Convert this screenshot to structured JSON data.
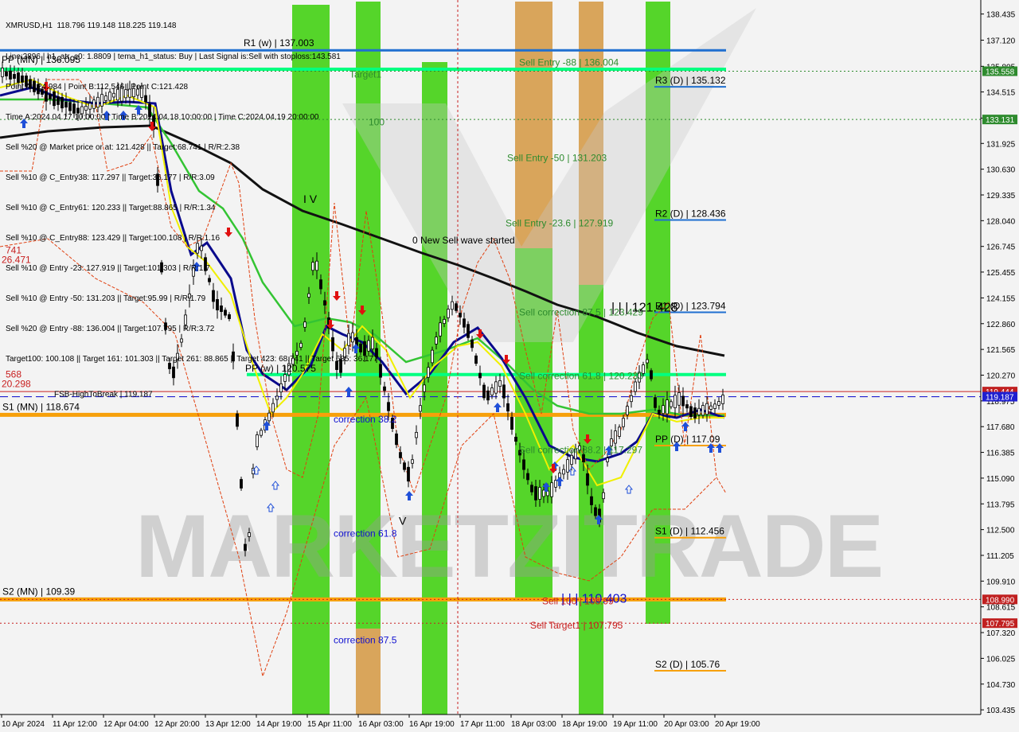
{
  "colors": {
    "background": "#f3f3f3",
    "green_zone": "#55d52a",
    "orange_zone": "#d9a55b",
    "pivot_line": "#1f6fd0",
    "support_line": "#f7a00a",
    "target_line": "#00ff80",
    "sma_black": "#111111",
    "ma_green": "#33c433",
    "ma_navy": "#0a0a8c",
    "ma_yellow": "#f0f000",
    "red_level": "#c82020",
    "current_price_bg": "#1f1fd0",
    "level_green_bg": "#2e8b2e",
    "level_red_bg": "#c02020"
  },
  "info_lines": [
    "XMRUSD,H1  118.796 119.148 118.225 119.148",
    "Line:2896 | h1_atr_c0: 1.8809 | tema_h1_status: Buy | Last Signal is:Sell with stoploss:143.581",
    "Point A:124.984 | Point B:112.546 | Point C:121.428",
    "Time A:2024.04.17 10:00:00 | Time B:2024.04.18 10:00:00 | Time C:2024.04.19 20:00:00",
    "Sell %20 @ Market price or at: 121.428 || Target:68.741 | R/R:2.38",
    "Sell %10 @ C_Entry38: 117.297 || Target:36.177 | R/R:3.09",
    "Sell %10 @ C_Entry61: 120.233 || Target:88.865 | R/R:1.34",
    "Sell %10 @ C_Entry88: 123.429 || Target:100.108 | R/R:1.16",
    "Sell %10 @ Entry -23: 127.919 || Target:101.303 | R/R:1.7",
    "Sell %10 @ Entry -50: 131.203 || Target:95.99 | R/R:1.79",
    "Sell %20 @ Entry -88: 136.004 || Target:107.795 | R/R:3.72",
    "Target100: 100.108 || Target 161: 101.303 || Target 261: 88.865 || Target 423: 68.741 || Target 685: 36.177"
  ],
  "chart_data": {
    "type": "candlestick",
    "symbol": "XMRUSD",
    "timeframe": "H1",
    "ylim": [
      103.2,
      138.9
    ],
    "y_ticks": [
      "138.435",
      "137.120",
      "135.805",
      "134.515",
      "133.200",
      "131.925",
      "130.630",
      "129.335",
      "128.040",
      "126.745",
      "125.455",
      "124.155",
      "122.860",
      "121.565",
      "120.270",
      "118.975",
      "117.680",
      "116.385",
      "115.090",
      "113.795",
      "112.500",
      "111.205",
      "109.910",
      "108.615",
      "107.320",
      "106.025",
      "104.730",
      "103.435"
    ],
    "x_labels": [
      "10 Apr 2024",
      "11 Apr 12:00",
      "12 Apr 04:00",
      "12 Apr 20:00",
      "13 Apr 12:00",
      "14 Apr 19:00",
      "15 Apr 11:00",
      "16 Apr 03:00",
      "16 Apr 19:00",
      "17 Apr 11:00",
      "18 Apr 03:00",
      "18 Apr 19:00",
      "19 Apr 11:00",
      "20 Apr 03:00",
      "20 Apr 19:00"
    ],
    "current_price": "119.187",
    "price_tags": [
      {
        "value": 135.558,
        "text": "135.558",
        "style": "green"
      },
      {
        "value": 133.131,
        "text": "133.131",
        "style": "green"
      },
      {
        "value": 119.444,
        "text": "119.444",
        "style": "red"
      },
      {
        "value": 119.187,
        "text": "119.187",
        "style": "blue"
      },
      {
        "value": 108.99,
        "text": "108.990",
        "style": "red"
      },
      {
        "value": 107.795,
        "text": "107.795",
        "style": "red"
      }
    ],
    "levels": [
      {
        "value": 137.003,
        "label": "R1 (w) | 137.003",
        "kind": "pivot_weekly"
      },
      {
        "value": 136.095,
        "label": "PP (MN) | 136.095",
        "kind": "pivot_monthly"
      },
      {
        "value": 135.132,
        "label": "R3 (D) | 135.132",
        "kind": "pivot_daily"
      },
      {
        "value": 128.436,
        "label": "R2 (D) | 128.436",
        "kind": "pivot_daily"
      },
      {
        "value": 123.794,
        "label": "R1 (D) | 123.794",
        "kind": "pivot_daily"
      },
      {
        "value": 120.575,
        "label": "PP (w) | 120.575",
        "kind": "pivot_weekly"
      },
      {
        "value": 118.674,
        "label": "S1 (MN) | 118.674",
        "kind": "support_monthly"
      },
      {
        "value": 117.09,
        "label": "PP (D) | 117.09",
        "kind": "pivot_daily"
      },
      {
        "value": 112.456,
        "label": "S1 (D) | 112.456",
        "kind": "pivot_daily"
      },
      {
        "value": 109.39,
        "label": "S2 (MN) | 109.39",
        "kind": "support_monthly"
      },
      {
        "value": 105.76,
        "label": "S2 (D) | 105.76",
        "kind": "pivot_daily"
      }
    ],
    "annotations": [
      {
        "text": "Sell Entry -88 | 136.004",
        "value": 136.004,
        "color": "#2e8b2e"
      },
      {
        "text": "Target1",
        "value": 135.4,
        "color": "#2e8b2e"
      },
      {
        "text": "100",
        "value": 133.0,
        "color": "#2e8b2e"
      },
      {
        "text": "Sell Entry -50 | 131.203",
        "value": 131.203,
        "color": "#2e8b2e"
      },
      {
        "text": "Sell Entry -23.6 | 127.919",
        "value": 127.919,
        "color": "#2e8b2e"
      },
      {
        "text": "0 New Sell wave started",
        "value": 127.05,
        "color": "#000000"
      },
      {
        "text": "I V",
        "value": 129.1,
        "color": "#000000"
      },
      {
        "text": "Sell correction 87.5 | 123.429",
        "value": 123.429,
        "color": "#2e8b2e"
      },
      {
        "text": "| | | 121.428",
        "value": 123.64,
        "color": "#000000"
      },
      {
        "text": "Sell correction 61.8 | 120.233",
        "value": 120.233,
        "color": "#2e8b2e"
      },
      {
        "text": "FSB-HighToBreak | 119.187",
        "value": 119.35,
        "color": "#000000"
      },
      {
        "text": "correction 38.2",
        "value": 118.05,
        "color": "#1010d0"
      },
      {
        "text": "Sell correction 38.2 | 117.297",
        "value": 116.5,
        "color": "#2e8b2e"
      },
      {
        "text": "V",
        "value": 112.9,
        "color": "#000000"
      },
      {
        "text": "correction 61.8",
        "value": 112.3,
        "color": "#1010d0"
      },
      {
        "text": "| | | 110.403",
        "value": 108.98,
        "color": "#1010d0"
      },
      {
        "text": "Sell 100 | 108.99",
        "value": 108.9,
        "color": "#c82020"
      },
      {
        "text": "Sell Target1 | 107.795",
        "value": 107.69,
        "color": "#c82020"
      },
      {
        "text": "correction 87.5",
        "value": 106.94,
        "color": "#1010d0"
      },
      {
        "text": "741",
        "value": 126.55,
        "color": "#c82020"
      },
      {
        "text": "26.471",
        "value": 126.08,
        "color": "#c82020"
      },
      {
        "text": "568",
        "value": 120.3,
        "color": "#c82020"
      },
      {
        "text": "20.298",
        "value": 119.83,
        "color": "#c82020"
      }
    ],
    "watermark": "MARKETZITRADE"
  }
}
